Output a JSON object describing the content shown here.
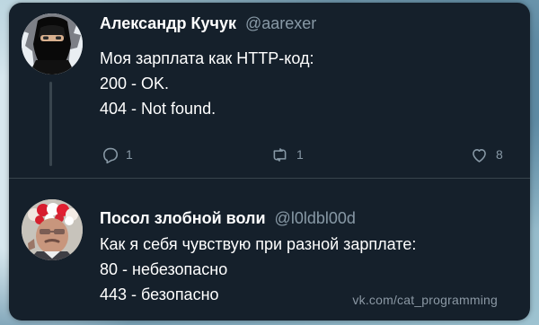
{
  "colors": {
    "card_background": "#15202b",
    "text_primary": "#ffffff",
    "text_secondary": "#8899a6",
    "divider": "#38444d",
    "page_background": "#8fb8cc"
  },
  "tweets": [
    {
      "author_name": "Александр Кучук",
      "author_handle": "@aarexer",
      "lines": [
        "Моя зарплата как HTTP-код:",
        "200 - OK.",
        "404 - Not found."
      ],
      "actions": {
        "reply_count": "1",
        "retweet_count": "1",
        "like_count": "8"
      },
      "icons": {
        "reply": "reply-icon",
        "retweet": "retweet-icon",
        "like": "heart-icon"
      }
    },
    {
      "author_name": "Посол злобной воли",
      "author_handle": "@l0ldbl00d",
      "lines": [
        "Как я себя чувствую при разной зарплате:",
        "80 - небезопасно",
        "443 - безопасно"
      ]
    }
  ],
  "watermark": "vk.com/cat_programming"
}
